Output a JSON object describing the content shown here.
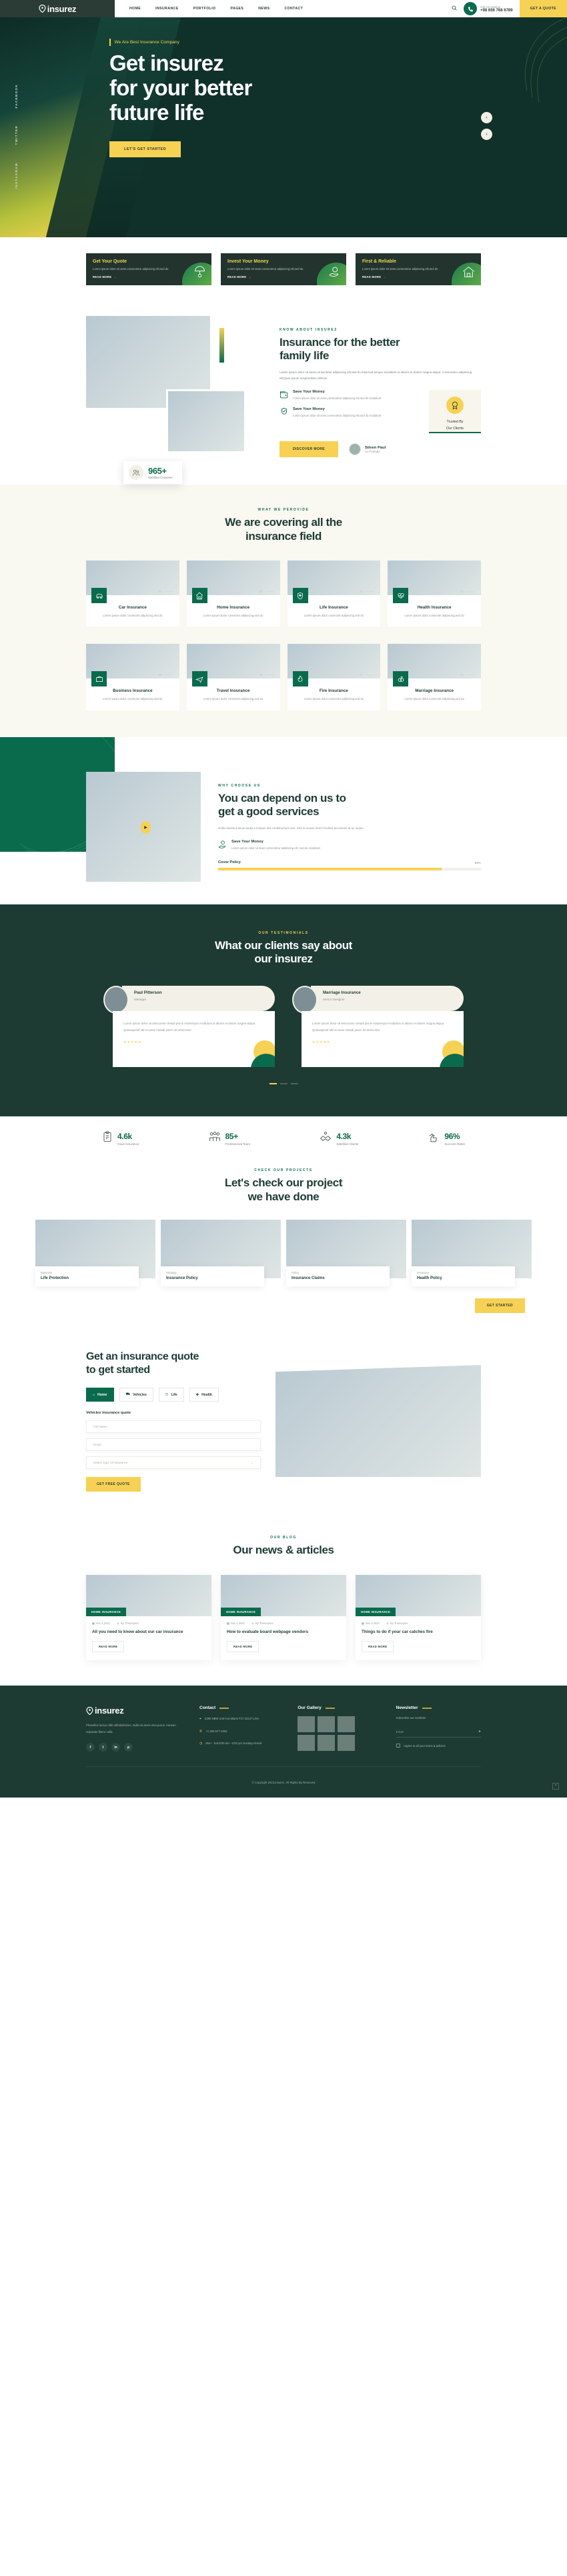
{
  "brand": {
    "name": "insurez",
    "logo_icon": "shield-pin-icon"
  },
  "header": {
    "nav": [
      {
        "label": "HOME"
      },
      {
        "label": "INSURANCE"
      },
      {
        "label": "PORTFOLIO"
      },
      {
        "label": "PAGES"
      },
      {
        "label": "NEWS"
      },
      {
        "label": "CONTACT"
      }
    ],
    "search_icon": "search-icon",
    "phone_icon": "phone-icon",
    "call_label": "Call Us Anytime",
    "call_number": "+98 656 768 6789",
    "quote_button": "GET A QUOTE"
  },
  "hero": {
    "eyebrow": "We Are Best Insurance Company",
    "title_line1": "Get insurez",
    "title_line2": "for your better",
    "title_line3": "future life",
    "cta": "LET'S GET STARTED",
    "social": [
      "FACEBOOK",
      "TWITTER",
      "INSTAGRAM"
    ],
    "arrow_prev_icon": "chevron-left-icon",
    "arrow_next_icon": "chevron-right-icon"
  },
  "feature_cards": [
    {
      "title": "Get Your Quote",
      "text": "Lorem ipsum dolor sit amet,consectetur adipiscing elit,sed do",
      "link": "READ MORE",
      "icon": "umbrella-dollar-icon"
    },
    {
      "title": "Invest Your Money",
      "text": "Lorem ipsum dolor sit amet,consectetur adipiscing elit,sed do",
      "link": "READ MORE",
      "icon": "hand-coin-icon"
    },
    {
      "title": "First & Reliable",
      "text": "Lorem ipsum dolor sit amet,consectetur adipiscing elit,sed do",
      "link": "READ MORE",
      "icon": "home-icon"
    }
  ],
  "about": {
    "tag": "KNOW ABOUT INSUREZ",
    "title_line1": "Insurance for the better",
    "title_line2": "family life",
    "lead": "Lorem ipsum dolor sit amet,consectetur adipiscing elit,sed do eiusmod tempor incididunt ut labore et dolore magna aliqua. consectetur adipiscing elit,Quis ipsum suspendisse ultrices",
    "items": [
      {
        "title": "Save Your Money",
        "text": "Lorem ipsum dolor sit amet,consectetur adipiscing elit,sed do incididunt",
        "icon": "wallet-icon"
      },
      {
        "title": "Save Your Money",
        "text": "Lorem ipsum dolor sit amet,consectetur adipiscing elit,sed do incididunt",
        "icon": "hand-shield-icon"
      }
    ],
    "trust_line1": "Trusted By",
    "trust_line2": "Our Clients",
    "trust_icon": "award-badge-icon",
    "cta": "DISCOVER MORE",
    "founder_name": "Stiven Paul",
    "founder_role": "Co Founder",
    "counter_value": "965+",
    "counter_label": "Satisfied Customer",
    "counter_icon": "users-icon"
  },
  "services": {
    "tag": "WHAT WE PEROVIDE",
    "title_line1": "We are covering all the",
    "title_line2": "insurance field",
    "cards": [
      {
        "num": "01",
        "title": "Car Insurance",
        "text": "Lorem ipsum dolor consectet adipiscing,sed do",
        "icon": "car-icon"
      },
      {
        "num": "02",
        "title": "Home Insurance",
        "text": "Lorem ipsum dolor consectet adipiscing,sed do",
        "icon": "home-icon"
      },
      {
        "num": "03",
        "title": "Life Insurance",
        "text": "Lorem ipsum dolor consectet adipiscing,sed do",
        "icon": "shield-heart-icon"
      },
      {
        "num": "04",
        "title": "Health Insurance",
        "text": "Lorem ipsum dolor consectet adipiscing,sed do",
        "icon": "heartbeat-icon"
      },
      {
        "num": "05",
        "title": "Business Insurance",
        "text": "Lorem ipsum dolor consectet adipiscing,sed do",
        "icon": "briefcase-icon"
      },
      {
        "num": "06",
        "title": "Travel Insurance",
        "text": "Lorem ipsum dolor consectet adipiscing,sed do",
        "icon": "airplane-icon"
      },
      {
        "num": "07",
        "title": "Fire Insurance",
        "text": "Lorem ipsum dolor consectet adipiscing,sed do",
        "icon": "fire-icon"
      },
      {
        "num": "08",
        "title": "Marriage Insurance",
        "text": "Lorem ipsum dolor consectet adipiscing,sed do",
        "icon": "rings-icon"
      }
    ]
  },
  "why": {
    "tag": "WHY CHOOSE US",
    "title_line1": "You can depend on us to",
    "title_line2": "get a good services",
    "lead": "Nulla maximus lacus turpis,a tempus nisi condimentum non. Sed in erosac lorem facilisis accumsan at ac neque.",
    "feature_title": "Save Your Money",
    "feature_text": "Lorem ipsum dolor sit amet,consectetur adipiscing elit, sed do incididunt",
    "feature_icon": "hand-coin-icon",
    "play_icon": "play-icon",
    "bars": [
      {
        "label": "Cover Policy",
        "value": "85%",
        "pct": 85
      }
    ]
  },
  "testimonials": {
    "tag": "OUR TESTIMONIALS",
    "title_line1": "What our clients say about",
    "title_line2": "our insurez",
    "cards": [
      {
        "name": "Paul Pitterson",
        "role": "Manager",
        "text": "Lorem ipsum dolor sit ameconse ctetadi piscin eiustempor incididunt ut labore et dolore magna aliqua. Quisuspendi ultri econse ctetadi piscin sit ameconse",
        "stars": "★★★★★"
      },
      {
        "name": "Marriage Insurance",
        "role": "Senior Designer",
        "text": "Lorem ipsum dolor sit ameconse ctetadi piscin eiustempor incididunt ut labore et dolore magna aliqua. Quisuspendi ultri econse ctetadi piscin sit ameconse",
        "stars": "★★★★★"
      }
    ]
  },
  "stats": [
    {
      "value": "4.6k",
      "label": "Gave Insurance",
      "icon": "clipboard-check-icon"
    },
    {
      "value": "85+",
      "label": "Professional Team",
      "icon": "team-icon"
    },
    {
      "value": "4.3k",
      "label": "Satisfied Clients",
      "icon": "handshake-icon"
    },
    {
      "value": "96%",
      "label": "Success Rates",
      "icon": "thumbs-up-star-icon"
    }
  ],
  "projects": {
    "tag": "CHECK OUR PROJECTS",
    "title_line1": "Let's check our project",
    "title_line2": "we have done",
    "cards": [
      {
        "cat": "Business",
        "title": "Life Protection"
      },
      {
        "cat": "Strategy",
        "title": "Insurance Policy"
      },
      {
        "cat": "Policy",
        "title": "Insurance Claims"
      },
      {
        "cat": "Insurance",
        "title": "Health Policy"
      }
    ],
    "cta": "GET STARTED"
  },
  "quote_form": {
    "title_line1": "Get an insurance quote",
    "title_line2": "to get started",
    "tabs": [
      {
        "label": "Home",
        "icon": "home-icon",
        "active": true
      },
      {
        "label": "Vehicles",
        "icon": "car-icon",
        "active": false
      },
      {
        "label": "Life",
        "icon": "heart-icon",
        "active": false
      },
      {
        "label": "Health",
        "icon": "health-icon",
        "active": false
      }
    ],
    "subtitle": "Vehicles insurance quote",
    "fields": [
      {
        "placeholder": "Full Name",
        "value": "",
        "type": "text"
      },
      {
        "placeholder": "Email",
        "value": "",
        "type": "text"
      },
      {
        "placeholder": "Select Type Of Insurance",
        "value": "",
        "type": "select",
        "icon": "chevron-down-icon"
      }
    ],
    "submit": "GET FREE QUOTE"
  },
  "blog": {
    "tag": "OUR BLOG",
    "title": "Our news & articles",
    "posts": [
      {
        "tag": "HOME INSURANCE",
        "date": "Nov 4,2022",
        "author": "By Themepure",
        "title": "All you need to know about our car insurance",
        "more": "READ MORE"
      },
      {
        "tag": "HOME INSURANCE",
        "date": "Nov 4,2022",
        "author": "By Themepure",
        "title": "How to evaluate board webpage vendors",
        "more": "READ MORE"
      },
      {
        "tag": "HOME INSURANCE",
        "date": "Nov 4,2022",
        "author": "By Themepure",
        "title": "Things to do if your car catches fire",
        "more": "READ MORE"
      }
    ]
  },
  "footer": {
    "about_text": "Phasellus luctus nibh utfinibultricies. Nulla sit amet urna purus. Aenean vulputate libero nulla.",
    "socials": [
      {
        "icon": "facebook-icon",
        "glyph": "f"
      },
      {
        "icon": "twitter-icon",
        "glyph": "🐦"
      },
      {
        "icon": "linkedin-icon",
        "glyph": "in"
      },
      {
        "icon": "pinterest-icon",
        "glyph": "p"
      }
    ],
    "contact_heading": "Contact",
    "contact_items": [
      {
        "icon": "location-icon",
        "text": "2390 NBW 2nd Ave,Miami FLT 33127,USA"
      },
      {
        "icon": "phone-icon",
        "text": "+1 305 677-4352"
      },
      {
        "icon": "clock-icon",
        "text": "Mon - Sat:8:00 am - 6:00 pm Sunday:closed"
      }
    ],
    "gallery_heading": "Our Gallery",
    "gallery_count": 6,
    "newsletter_heading": "Newsletter",
    "newsletter_sub": "Subscribe our newleter",
    "newsletter_placeholder": "Email",
    "newsletter_send_icon": "send-icon",
    "newsletter_agree": "I agree to all your terms & policies",
    "copyright": "© Copyright 2023,Insurez. All Rights By Reserved",
    "to_top_icon": "chevron-up-icon"
  }
}
